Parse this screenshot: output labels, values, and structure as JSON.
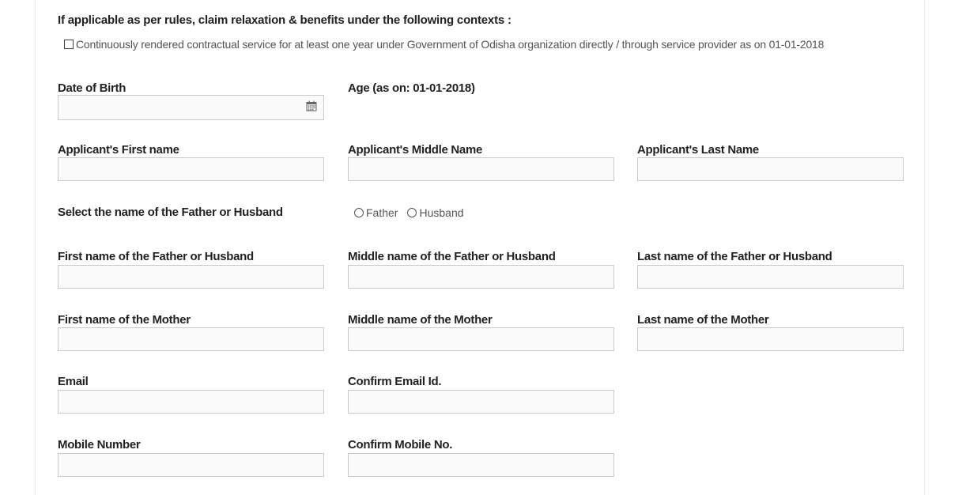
{
  "intro": {
    "heading": "If applicable as per rules, claim relaxation & benefits under the following contexts :",
    "checkbox_label": "Continuously rendered contractual service for at least one year under Government of Odisha organization directly / through service provider as on 01-01-2018",
    "checked": false
  },
  "dob": {
    "label": "Date of Birth",
    "value": "",
    "icon": "calendar-icon",
    "age_label": "Age (as on: 01-01-2018)"
  },
  "applicant": {
    "first_label": "Applicant's First name",
    "middle_label": "Applicant's Middle Name",
    "last_label": "Applicant's Last Name"
  },
  "relation": {
    "label": "Select the name of the Father or Husband",
    "options": [
      "Father",
      "Husband"
    ],
    "selected": null
  },
  "father_husband": {
    "first_label": "First name of the Father or Husband",
    "middle_label": "Middle name of the Father or Husband",
    "last_label": "Last name of the Father or Husband"
  },
  "mother": {
    "first_label": "First name of the Mother",
    "middle_label": "Middle name of the Mother",
    "last_label": "Last name of the Mother"
  },
  "email": {
    "label": "Email",
    "confirm_label": "Confirm Email Id."
  },
  "mobile": {
    "label": "Mobile Number",
    "confirm_label": "Confirm Mobile No."
  }
}
